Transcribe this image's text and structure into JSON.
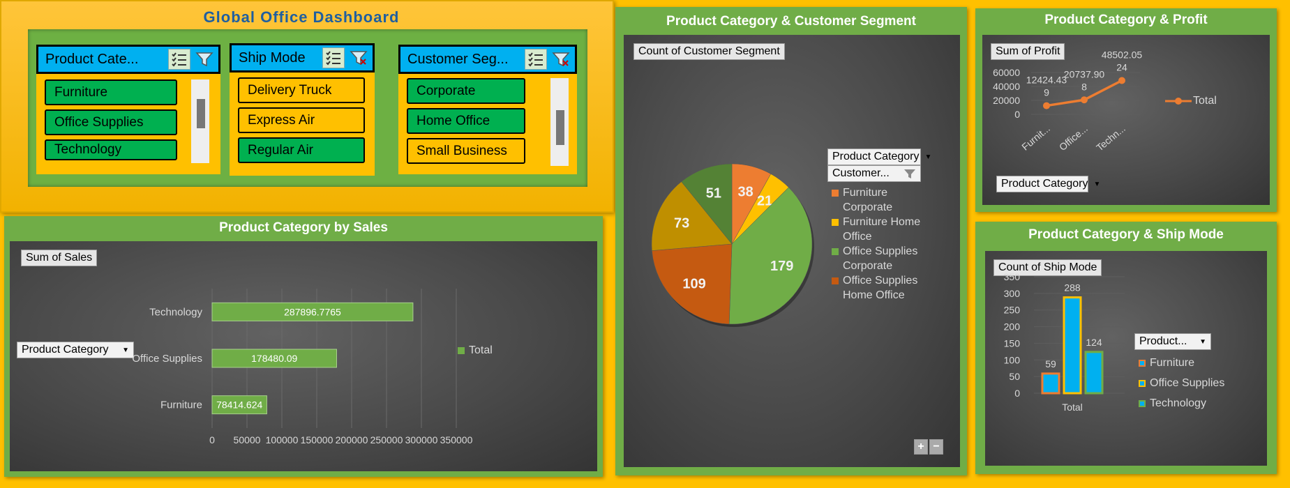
{
  "dashboard": {
    "title": "Global Office Dashboard"
  },
  "slicers": {
    "product_category": {
      "header": "Product Cate...",
      "items": [
        {
          "label": "Furniture",
          "selected": true
        },
        {
          "label": "Office Supplies",
          "selected": true
        },
        {
          "label": "Technology",
          "selected": true
        }
      ]
    },
    "ship_mode": {
      "header": "Ship Mode",
      "items": [
        {
          "label": "Delivery Truck",
          "selected": false
        },
        {
          "label": "Express Air",
          "selected": false
        },
        {
          "label": "Regular Air",
          "selected": true
        }
      ]
    },
    "customer_segment": {
      "header": "Customer Seg...",
      "items": [
        {
          "label": "Corporate",
          "selected": true
        },
        {
          "label": "Home Office",
          "selected": true
        },
        {
          "label": "Small Business",
          "selected": false
        }
      ]
    }
  },
  "sales_panel": {
    "title": "Product Category by Sales",
    "value_button": "Sum of Sales",
    "axis_button": "Product Category",
    "legend": "Total"
  },
  "segment_panel": {
    "title": "Product Category & Customer Segment",
    "value_button": "Count of Customer Segment",
    "filter1": "Product Category",
    "filter2": "Customer...",
    "legend": [
      "Furniture Corporate",
      "Furniture Home Office",
      "Office Supplies Corporate",
      "Office Supplies Home Office"
    ],
    "zoom_in": "+",
    "zoom_out": "−"
  },
  "profit_panel": {
    "title": "Product Category & Profit",
    "value_button": "Sum of Profit",
    "axis_button": "Product Category",
    "legend": "Total"
  },
  "shipmode_panel": {
    "title": "Product Category & Ship Mode",
    "value_button": "Count of Ship Mode",
    "filter": "Product...",
    "legend": [
      "Furniture",
      "Office Supplies",
      "Technology"
    ]
  },
  "colors": {
    "accent_green": "#70ad47",
    "slicer_blue": "#00b0f0",
    "selected_green": "#00b050",
    "background_gold": "#ffc000",
    "line_orange": "#ed7d31"
  },
  "chart_data": [
    {
      "type": "bar",
      "title": "Product Category by Sales",
      "categories": [
        "Furniture",
        "Office Supplies",
        "Technology"
      ],
      "series": [
        {
          "name": "Total",
          "values": [
            78414.624,
            178480.09,
            287896.7765
          ]
        }
      ],
      "data_labels": [
        "78414.624",
        "178480.09",
        "287896.7765"
      ],
      "xticks": [
        "0",
        "50000",
        "100000",
        "150000",
        "200000",
        "250000",
        "300000",
        "350000"
      ],
      "xlim": [
        0,
        350000
      ],
      "orientation": "horizontal"
    },
    {
      "type": "pie",
      "title": "Product Category & Customer Segment",
      "slices": [
        {
          "value": 38,
          "color": "#ed7d31"
        },
        {
          "value": 21,
          "color": "#ffc000"
        },
        {
          "value": 179,
          "color": "#70ad47"
        },
        {
          "value": 109,
          "color": "#c55a11"
        },
        {
          "value": 73,
          "color": "#bf8f00"
        },
        {
          "value": 51,
          "color": "#548235"
        }
      ],
      "legend_colors": [
        "#ed7d31",
        "#ffc000",
        "#70ad47",
        "#c55a11"
      ]
    },
    {
      "type": "line",
      "title": "Product Category & Profit",
      "categories": [
        "Furnit...",
        "Office...",
        "Techn..."
      ],
      "series": [
        {
          "name": "Total",
          "values": [
            12424.439,
            20737.908,
            48502.0524
          ]
        }
      ],
      "data_labels": [
        "12424.43\n9",
        "20737.90\n8",
        "48502.05\n24"
      ],
      "yticks": [
        "0",
        "20000",
        "40000",
        "60000"
      ],
      "ylim": [
        0,
        60000
      ]
    },
    {
      "type": "bar",
      "title": "Product Category & Ship Mode",
      "categories": [
        "Total"
      ],
      "series": [
        {
          "name": "Furniture",
          "values": [
            59
          ]
        },
        {
          "name": "Office Supplies",
          "values": [
            288
          ]
        },
        {
          "name": "Technology",
          "values": [
            124
          ]
        }
      ],
      "yticks": [
        "0",
        "50",
        "100",
        "150",
        "200",
        "250",
        "300",
        "350"
      ],
      "ylim": [
        0,
        350
      ],
      "series_colors": [
        "#00b0f0",
        "#00b0f0",
        "#00b0f0"
      ],
      "border_colors": [
        "#ed7d31",
        "#ffc000",
        "#70ad47"
      ]
    }
  ]
}
